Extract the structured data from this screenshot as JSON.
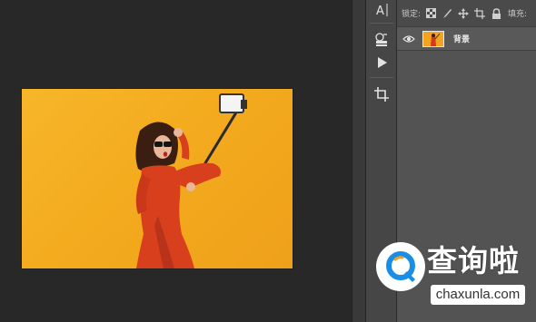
{
  "tools": [
    {
      "icon": "character-panel-icon"
    },
    {
      "icon": "3d-layers-icon"
    },
    {
      "icon": "play-actions-icon"
    },
    {
      "icon": "crop-icon"
    }
  ],
  "layers_panel": {
    "lock_label": "锁定:",
    "lock_icons": [
      "lock-transparent-pixels-icon",
      "lock-image-pixels-icon",
      "lock-position-icon",
      "lock-artboard-icon",
      "lock-all-icon"
    ],
    "fill_label": "填充:",
    "layers": [
      {
        "name": "背景",
        "visible": true,
        "icon": "eye-icon"
      }
    ]
  },
  "document": {
    "background_color": "#f4ab1e",
    "subject": "woman in red dress with selfie stick"
  },
  "watermark": {
    "title": "查询啦",
    "url": "chaxunla.com",
    "accent": "#1a8ee6"
  }
}
